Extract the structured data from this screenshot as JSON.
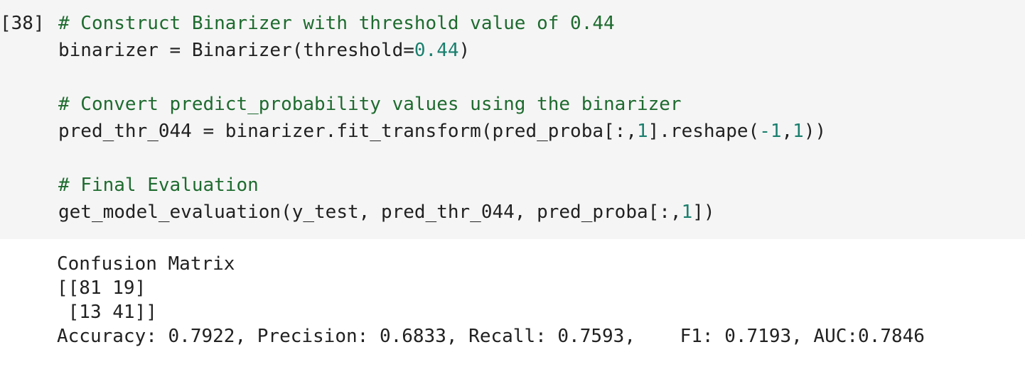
{
  "cell": {
    "execution_count": "[38]"
  },
  "code": {
    "line1_comment": "# Construct Binarizer with threshold value of 0.44",
    "line2_a": "binarizer = Binarizer(threshold=",
    "line2_num": "0.44",
    "line2_b": ")",
    "line4_comment": "# Convert predict_probability values using the binarizer",
    "line5_a": "pred_thr_044 = binarizer.fit_transform(pred_proba[:,",
    "line5_num1": "1",
    "line5_b": "].reshape(",
    "line5_num2": "-1",
    "line5_c": ",",
    "line5_num3": "1",
    "line5_d": "))",
    "line7_comment": "# Final Evaluation",
    "line8_a": "get_model_evaluation(y_test, pred_thr_044, pred_proba[:,",
    "line8_num": "1",
    "line8_b": "])"
  },
  "output": {
    "line1": "Confusion Matrix",
    "line2": "[[81 19]",
    "line3": " [13 41]]",
    "line4": "Accuracy: 0.7922, Precision: 0.6833, Recall: 0.7593,    F1: 0.7193, AUC:0.7846"
  },
  "colors": {
    "input_background": "#f5f5f5",
    "comment": "#1e6b2f",
    "number": "#1a7f6e",
    "text": "#212121"
  }
}
